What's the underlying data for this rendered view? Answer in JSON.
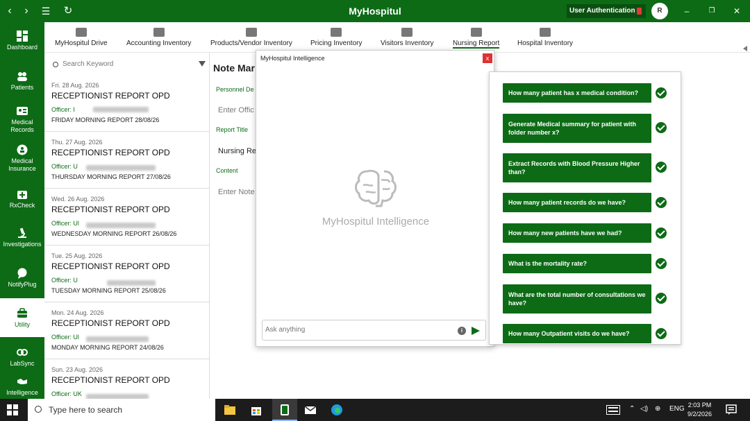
{
  "app": {
    "title": "MyHospitul",
    "auth_label": "User Authentication",
    "avatar_initial": "R"
  },
  "sidebar": {
    "items": [
      {
        "label": "Dashboard"
      },
      {
        "label": "Patients"
      },
      {
        "label": "Medical Records"
      },
      {
        "label": "Medical Insurance"
      },
      {
        "label": "RxCheck"
      },
      {
        "label": "Investigations"
      },
      {
        "label": "NotifyPlug"
      },
      {
        "label": "Utility"
      },
      {
        "label": "LabSync"
      },
      {
        "label": "Intelligence"
      }
    ]
  },
  "topnav": {
    "items": [
      {
        "label": "MyHospitul Drive"
      },
      {
        "label": "Accounting Inventory"
      },
      {
        "label": "Products/Vendor Inventory"
      },
      {
        "label": "Pricing Inventory"
      },
      {
        "label": "Visitors Inventory"
      },
      {
        "label": "Nursing Report"
      },
      {
        "label": "Hospital Inventory"
      }
    ]
  },
  "list": {
    "search_placeholder": "Search Keyword",
    "reports": [
      {
        "date": "Fri. 28 Aug. 2026",
        "title": "RECEPTIONIST REPORT OPD",
        "officer": "Officer: I",
        "summary": "FRIDAY MORNING REPORT 28/08/26"
      },
      {
        "date": "Thu. 27 Aug. 2026",
        "title": "RECEPTIONIST REPORT OPD",
        "officer": "Officer: U",
        "summary": "THURSDAY MORNING REPORT 27/08/26"
      },
      {
        "date": "Wed. 26 Aug. 2026",
        "title": "RECEPTIONIST REPORT OPD",
        "officer": "Officer: Ul",
        "summary": "WEDNESDAY MORNING REPORT 26/08/26"
      },
      {
        "date": "Tue. 25 Aug. 2026",
        "title": "RECEPTIONIST REPORT OPD",
        "officer": "Officer: U",
        "summary": "TUESDAY MORNING REPORT 25/08/26"
      },
      {
        "date": "Mon. 24 Aug. 2026",
        "title": "RECEPTIONIST REPORT OPD",
        "officer": "Officer: Ul",
        "summary": "MONDAY MORNING REPORT 24/08/26"
      },
      {
        "date": "Sun. 23 Aug. 2026",
        "title": "RECEPTIONIST REPORT OPD",
        "officer": "Officer: UK",
        "summary": ""
      }
    ]
  },
  "main": {
    "title": "Note Mar",
    "personnel_label": "Personnel De",
    "officer_placeholder": "Enter Offic",
    "report_title_label": "Report Title",
    "report_title_value": "Nursing Re",
    "content_label": "Content",
    "note_placeholder": "Enter Note"
  },
  "dialog": {
    "title": "MyHospitul Intelligence",
    "close_label": "x",
    "logo_text": "MyHospitul Intelligence",
    "chat_placeholder": "Ask anything",
    "info_label": "i"
  },
  "questions": [
    "How many patient has x medical condition?",
    "Generate Medical summary for patient with folder number x?",
    "Extract Records with Blood Pressure Higher than?",
    "How many patient records do we have?",
    "How many new patients have we had?",
    "What is the mortality rate?",
    "What are the total number of consultations we have?",
    "How many Outpatient visits do we have?"
  ],
  "taskbar": {
    "search_placeholder": "Type here to search",
    "language": "ENG",
    "time": "2:03 PM",
    "date": "9/2/2026"
  }
}
